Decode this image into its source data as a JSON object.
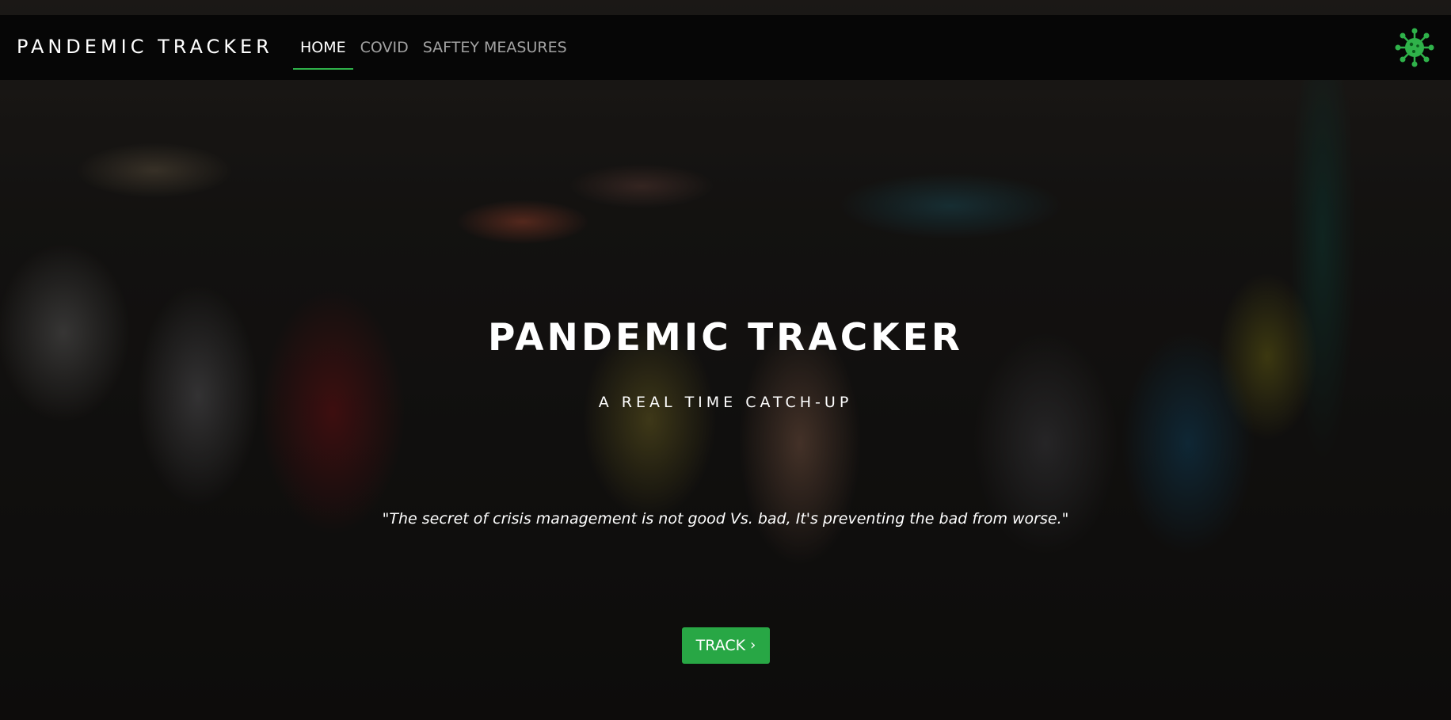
{
  "navbar": {
    "brand": "PANDEMIC TRACKER",
    "links": [
      {
        "label": "HOME",
        "active": true
      },
      {
        "label": "COVID",
        "active": false
      },
      {
        "label": "SAFTEY MEASURES",
        "active": false
      }
    ],
    "logo_icon": "virus-icon",
    "accent_color": "#2fb24a"
  },
  "hero": {
    "title": "PANDEMIC TRACKER",
    "subtitle": "A REAL TIME CATCH-UP",
    "quote": "\"The secret of crisis management is not good Vs. bad, It's preventing the bad from worse.\"",
    "cta": {
      "label": "TRACK",
      "icon": "chevron-right-icon",
      "color": "#28a745"
    }
  }
}
